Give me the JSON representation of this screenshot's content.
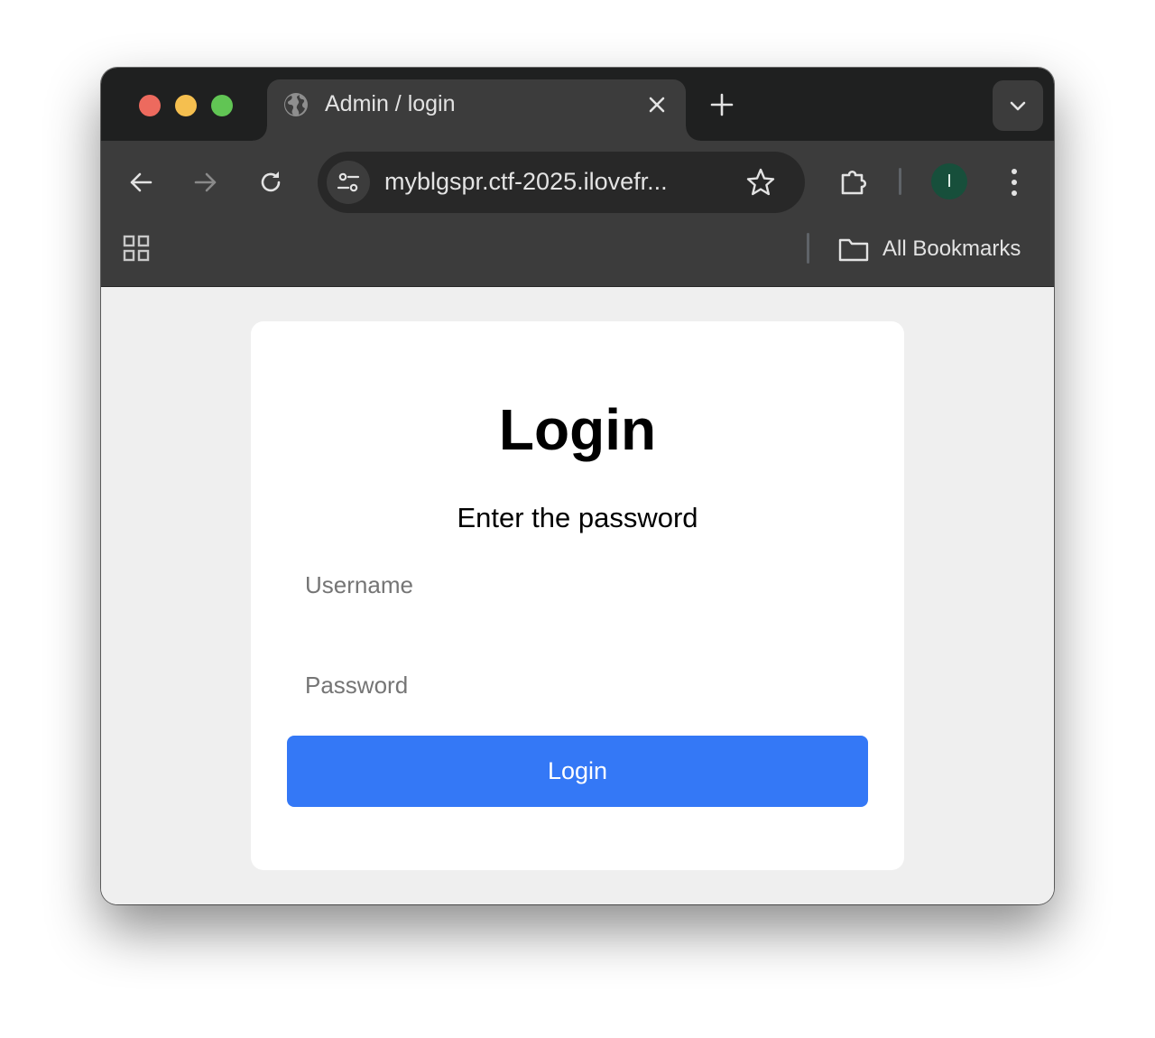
{
  "browser": {
    "tab": {
      "title": "Admin / login",
      "favicon": "globe-icon"
    },
    "address_bar": {
      "url": "myblgspr.ctf-2025.ilovefr..."
    },
    "profile": {
      "initial": "I",
      "color": "#174f3b"
    },
    "bookmarks_bar": {
      "all_bookmarks_label": "All Bookmarks"
    }
  },
  "page": {
    "title": "Login",
    "subtitle": "Enter the password",
    "username_field": {
      "value": "",
      "placeholder": "Username"
    },
    "password_field": {
      "value": "",
      "placeholder": "Password"
    },
    "submit_label": "Login"
  },
  "colors": {
    "accent": "#3478f6",
    "page_background": "#efefef",
    "chrome_dark": "#3c3c3c"
  }
}
